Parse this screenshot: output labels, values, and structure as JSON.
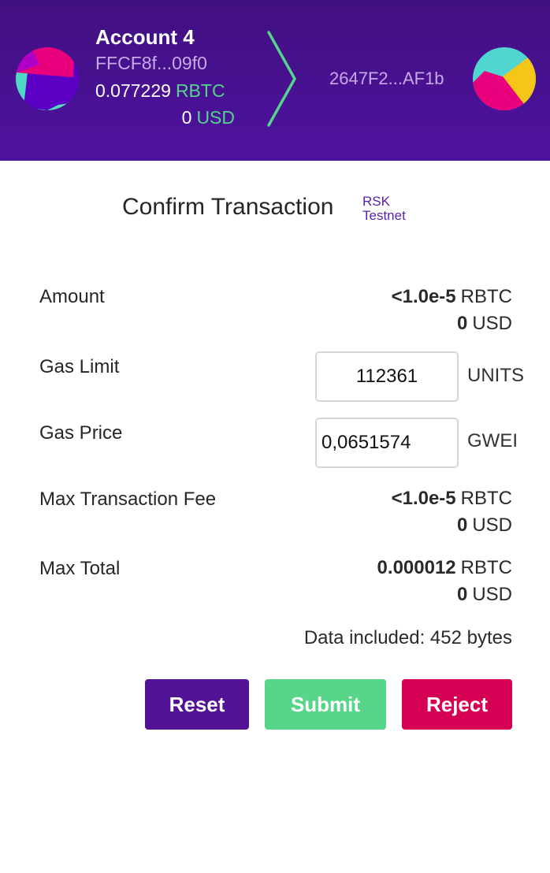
{
  "header": {
    "from_account": {
      "name": "Account 4",
      "address": "FFCF8f...09f0",
      "balance": "0.077229",
      "balance_currency": "RBTC",
      "fiat_balance": "0",
      "fiat_currency": "USD",
      "avatar_icon": "identicon-avatar"
    },
    "arrow_icon": "chevron-right-icon",
    "to_account": {
      "address": "2647F2...AF1b",
      "avatar_icon": "identicon-avatar"
    },
    "colors": {
      "background": "#4a1196",
      "accent_green": "#55d48c",
      "address_text": "#c7a9e8"
    }
  },
  "main": {
    "title": "Confirm Transaction",
    "network_line1": "RSK",
    "network_line2": "Testnet",
    "amount": {
      "label": "Amount",
      "value": "<1.0e-5",
      "currency": "RBTC",
      "fiat_value": "0",
      "fiat_currency": "USD"
    },
    "gas_limit": {
      "label": "Gas Limit",
      "value": "112361",
      "unit": "UNITS"
    },
    "gas_price": {
      "label": "Gas Price",
      "value": "0,0651574",
      "unit": "GWEI"
    },
    "max_fee": {
      "label": "Max Transaction Fee",
      "value": "<1.0e-5",
      "currency": "RBTC",
      "fiat_value": "0",
      "fiat_currency": "USD"
    },
    "max_total": {
      "label": "Max Total",
      "value": "0.000012",
      "currency": "RBTC",
      "fiat_value": "0",
      "fiat_currency": "USD"
    },
    "data_included": "Data included: 452 bytes"
  },
  "buttons": {
    "reset": "Reset",
    "submit": "Submit",
    "reject": "Reject",
    "colors": {
      "reset": "#521296",
      "submit": "#57d68a",
      "reject": "#d50054"
    }
  }
}
